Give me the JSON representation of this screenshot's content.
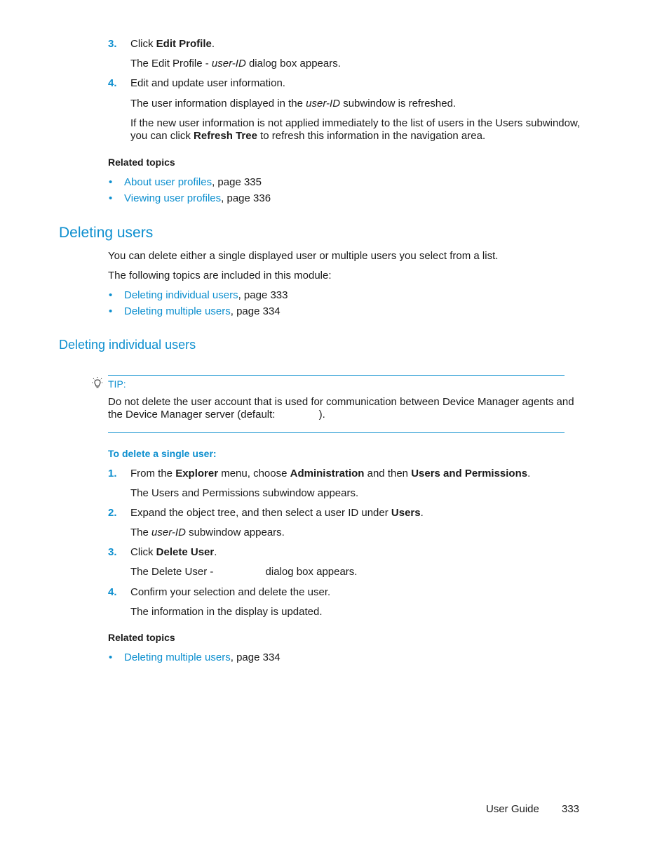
{
  "top_steps": [
    {
      "num": "3.",
      "pre": "Click ",
      "bold": "Edit Profile",
      "post": ".",
      "result_pre": "The Edit Profile - ",
      "result_italic": "user-ID",
      "result_post": " dialog box appears."
    },
    {
      "num": "4.",
      "text": "Edit and update user information.",
      "result_pre": "The user information displayed in the ",
      "result_italic": "user-ID",
      "result_post": " subwindow is refreshed.",
      "note_line1": "If the new user information is not applied immediately to the list of users in the Users subwindow,",
      "note_line2_pre": "you can click ",
      "note_line2_bold": "Refresh Tree",
      "note_line2_post": " to refresh this information in the navigation area."
    }
  ],
  "related_topics_1": {
    "heading": "Related topics",
    "items": [
      {
        "link": "About user profiles",
        "suffix": ", page 335"
      },
      {
        "link": "Viewing user profiles",
        "suffix": ", page 336"
      }
    ]
  },
  "section_deleting_users": {
    "title": "Deleting users",
    "intro": "You can delete either a single displayed user or multiple users you select from a list.",
    "topics_intro": "The following topics are included in this module:",
    "items": [
      {
        "link": "Deleting individual users",
        "suffix": ", page 333"
      },
      {
        "link": "Deleting multiple users",
        "suffix": ", page 334"
      }
    ]
  },
  "section_individual": {
    "title": "Deleting individual users",
    "tip": {
      "label": "TIP:",
      "line1": "Do not delete the user account that is used for communication between Device Manager agents and",
      "line2_pre": "the Device Manager server (default: ",
      "line2_post": ")."
    },
    "procedure_title": "To delete a single user:",
    "steps": [
      {
        "num": "1.",
        "parts": [
          "From the ",
          "Explorer",
          " menu, choose ",
          "Administration",
          " and then ",
          "Users and Permissions",
          "."
        ],
        "result": "The Users and Permissions subwindow appears."
      },
      {
        "num": "2.",
        "pre": "Expand the object tree, and then select a user ID under ",
        "bold": "Users",
        "post": ".",
        "result_pre": "The ",
        "result_italic": "user-ID",
        "result_post": " subwindow appears."
      },
      {
        "num": "3.",
        "pre": "Click ",
        "bold": "Delete User",
        "post": ".",
        "result_pre": "The Delete User - ",
        "result_post": "dialog box appears."
      },
      {
        "num": "4.",
        "text": "Confirm your selection and delete the user.",
        "result": "The information in the display is updated."
      }
    ],
    "related_heading": "Related topics",
    "related_items": [
      {
        "link": "Deleting multiple users",
        "suffix": ", page 334"
      }
    ]
  },
  "footer": {
    "label": "User Guide",
    "page": "333"
  }
}
